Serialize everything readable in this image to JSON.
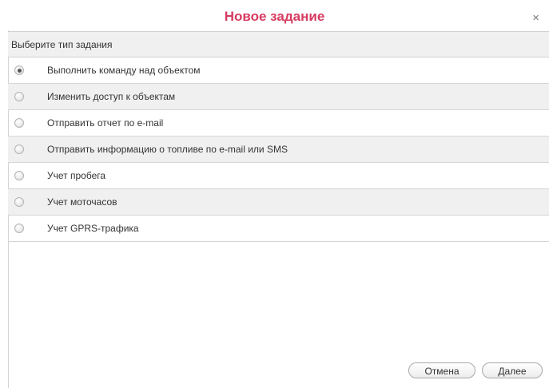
{
  "dialog": {
    "title": "Новое задание",
    "close_glyph": "×"
  },
  "panel": {
    "header": "Выберите тип задания",
    "options": [
      {
        "label": "Выполнить команду над объектом",
        "checked": true
      },
      {
        "label": "Изменить доступ к объектам",
        "checked": false
      },
      {
        "label": "Отправить отчет по e-mail",
        "checked": false
      },
      {
        "label": "Отправить информацию о топливе по e-mail или SMS",
        "checked": false
      },
      {
        "label": "Учет пробега",
        "checked": false
      },
      {
        "label": "Учет моточасов",
        "checked": false
      },
      {
        "label": "Учет GPRS-трафика",
        "checked": false
      }
    ]
  },
  "footer": {
    "cancel_label": "Отмена",
    "next_label": "Далее"
  },
  "colors": {
    "title": "#d63b60",
    "row_alt": "#f0f0f0",
    "border": "#d6d6d6"
  }
}
